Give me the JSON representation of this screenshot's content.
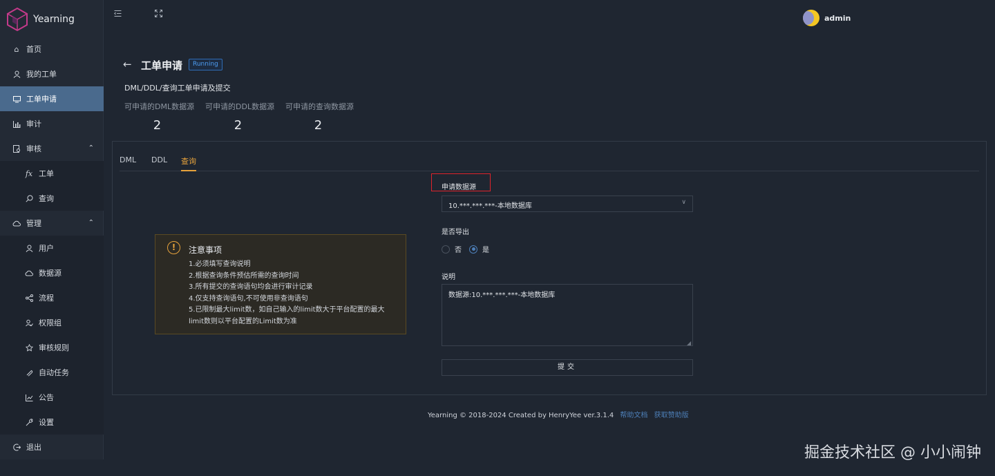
{
  "app": {
    "name": "Yearning",
    "logo_icon": "cube-logo-icon"
  },
  "topbar": {
    "menu_toggle_icon": "menu-fold-icon",
    "fullscreen_icon": "fullscreen-icon",
    "user_name": "admin"
  },
  "sidebar": {
    "items": [
      {
        "label": "首页",
        "icon": "home-icon"
      },
      {
        "label": "我的工单",
        "icon": "user-icon"
      },
      {
        "label": "工单申请",
        "icon": "monitor-icon",
        "active": true
      },
      {
        "label": "审计",
        "icon": "bar-chart-icon"
      },
      {
        "label": "审核",
        "icon": "audit-icon",
        "expanded": true
      },
      {
        "label": "工单",
        "icon": "fx-icon",
        "sub": true
      },
      {
        "label": "查询",
        "icon": "search-icon",
        "sub": true
      },
      {
        "label": "管理",
        "icon": "cloud-icon",
        "expanded": true
      },
      {
        "label": "用户",
        "icon": "user-icon",
        "sub": true
      },
      {
        "label": "数据源",
        "icon": "database-icon",
        "sub": true
      },
      {
        "label": "流程",
        "icon": "flow-icon",
        "sub": true
      },
      {
        "label": "权限组",
        "icon": "group-icon",
        "sub": true
      },
      {
        "label": "审核规则",
        "icon": "rule-icon",
        "sub": true
      },
      {
        "label": "自动任务",
        "icon": "task-icon",
        "sub": true
      },
      {
        "label": "公告",
        "icon": "chart-icon",
        "sub": true
      },
      {
        "label": "设置",
        "icon": "wrench-icon",
        "sub": true
      },
      {
        "label": "退出",
        "icon": "logout-icon"
      }
    ]
  },
  "header": {
    "title": "工单申请",
    "status": "Running",
    "description": "DML/DDL/查询工单申请及提交",
    "stats": [
      {
        "label": "可申请的DML数据源",
        "value": "2"
      },
      {
        "label": "可申请的DDL数据源",
        "value": "2"
      },
      {
        "label": "可申请的查询数据源",
        "value": "2"
      }
    ]
  },
  "tabs": [
    {
      "label": "DML"
    },
    {
      "label": "DDL"
    },
    {
      "label": "查询",
      "active": true
    }
  ],
  "notice": {
    "title": "注意事项",
    "icon": "warning-icon",
    "lines": [
      "1.必须填写查询说明",
      "2.根据查询条件预估所需的查询时间",
      "3.所有提交的查询语句均会进行审计记录",
      "4.仅支持查询语句,不可使用非查询语句",
      "5.已限制最大limit数，如自己输入的limit数大于平台配置的最大",
      "limit数则以平台配置的Limit数为准"
    ]
  },
  "form": {
    "source_label": "申请数据源",
    "source_value": "10.***.***.***-本地数据库",
    "export_label": "是否导出",
    "export_options": [
      {
        "label": "否",
        "checked": false
      },
      {
        "label": "是",
        "checked": true
      }
    ],
    "note_label": "说明",
    "note_value": "数据源:10.***.***.***-本地数据库",
    "submit_label": "提交"
  },
  "footer": {
    "text": "Yearning © 2018-2024 Created by HenryYee ver.3.1.4",
    "links": [
      "帮助文档",
      "获取赞助版"
    ]
  },
  "watermark": "掘金技术社区 @ 小小闹钟",
  "colors": {
    "background": "#1f2631",
    "sidebar_active": "#4a6a8d",
    "accent": "#e6a23c",
    "link": "#4d7fb8",
    "highlight_box": "#e0232b"
  }
}
